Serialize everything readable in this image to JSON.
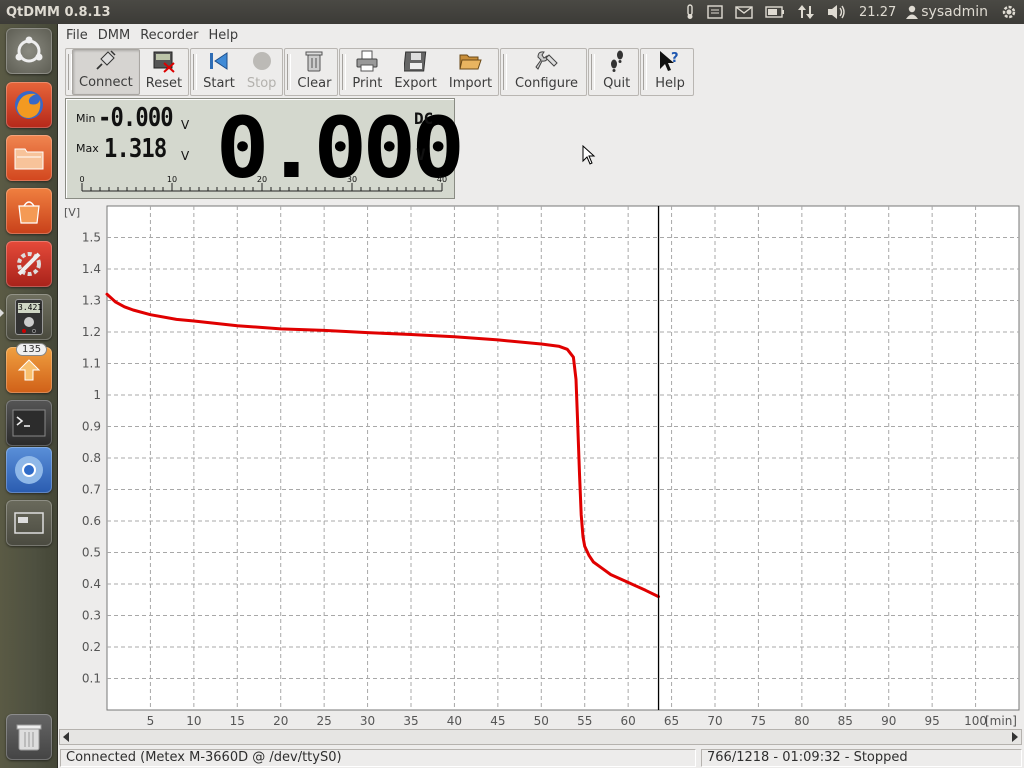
{
  "window": {
    "title": "QtDMM 0.8.13"
  },
  "panel": {
    "clock": "21.27",
    "user": "sysadmin"
  },
  "launcher": {
    "update_badge": "135",
    "dmm_icon_text": "3.421"
  },
  "menu": [
    "File",
    "DMM",
    "Recorder",
    "Help"
  ],
  "toolbar": {
    "groups": [
      [
        {
          "label": "Connect",
          "icon": "plug-icon",
          "active": true
        },
        {
          "label": "Reset",
          "icon": "reset-icon"
        }
      ],
      [
        {
          "label": "Start",
          "icon": "start-icon"
        },
        {
          "label": "Stop",
          "icon": "stop-icon",
          "disabled": true
        }
      ],
      [
        {
          "label": "Clear",
          "icon": "trash-icon"
        }
      ],
      [
        {
          "label": "Print",
          "icon": "printer-icon"
        },
        {
          "label": "Export",
          "icon": "floppy-icon"
        },
        {
          "label": "Import",
          "icon": "folder-icon"
        }
      ],
      [
        {
          "label": "Configure",
          "icon": "wrench-icon"
        }
      ],
      [
        {
          "label": "Quit",
          "icon": "footprints-icon"
        }
      ],
      [
        {
          "label": "Help",
          "icon": "help-icon"
        }
      ]
    ]
  },
  "display": {
    "min_label": "Min",
    "min_value": "-0.000",
    "min_unit": "V",
    "max_label": "Max",
    "max_value": "1.318",
    "max_unit": "V",
    "value": "0.000",
    "mode": "DC",
    "unit": "V",
    "scale_labels": [
      "0",
      "10",
      "20",
      "30",
      "40"
    ]
  },
  "chart_data": {
    "type": "line",
    "ylabel": "[V]",
    "xlabel": "[min]",
    "xlim": [
      0,
      105
    ],
    "ylim": [
      0,
      1.6
    ],
    "yticks": [
      0.1,
      0.2,
      0.3,
      0.4,
      0.5,
      0.6,
      0.7,
      0.8,
      0.9,
      1,
      1.1,
      1.2,
      1.3,
      1.4,
      1.5
    ],
    "xticks": [
      5,
      10,
      15,
      20,
      25,
      30,
      35,
      40,
      45,
      50,
      55,
      60,
      65,
      70,
      75,
      80,
      85,
      90,
      95,
      100
    ],
    "grid": true,
    "cursor_x": 63.5,
    "series": [
      {
        "color": "#e00000",
        "x": [
          0,
          1,
          2,
          3,
          5,
          8,
          10,
          15,
          20,
          25,
          30,
          35,
          40,
          45,
          50,
          52,
          53,
          53.7,
          54.0,
          54.2,
          54.4,
          54.6,
          54.8,
          55.0,
          55.5,
          56,
          57,
          58,
          60,
          62,
          63.5
        ],
        "y": [
          1.32,
          1.295,
          1.28,
          1.27,
          1.255,
          1.24,
          1.235,
          1.22,
          1.21,
          1.205,
          1.198,
          1.192,
          1.185,
          1.175,
          1.162,
          1.155,
          1.145,
          1.12,
          1.05,
          0.9,
          0.75,
          0.62,
          0.55,
          0.52,
          0.49,
          0.47,
          0.45,
          0.43,
          0.405,
          0.38,
          0.36
        ]
      }
    ]
  },
  "status": {
    "left": "Connected (Metex M-3660D @ /dev/ttyS0)",
    "right": "766/1218 - 01:09:32 - Stopped"
  }
}
